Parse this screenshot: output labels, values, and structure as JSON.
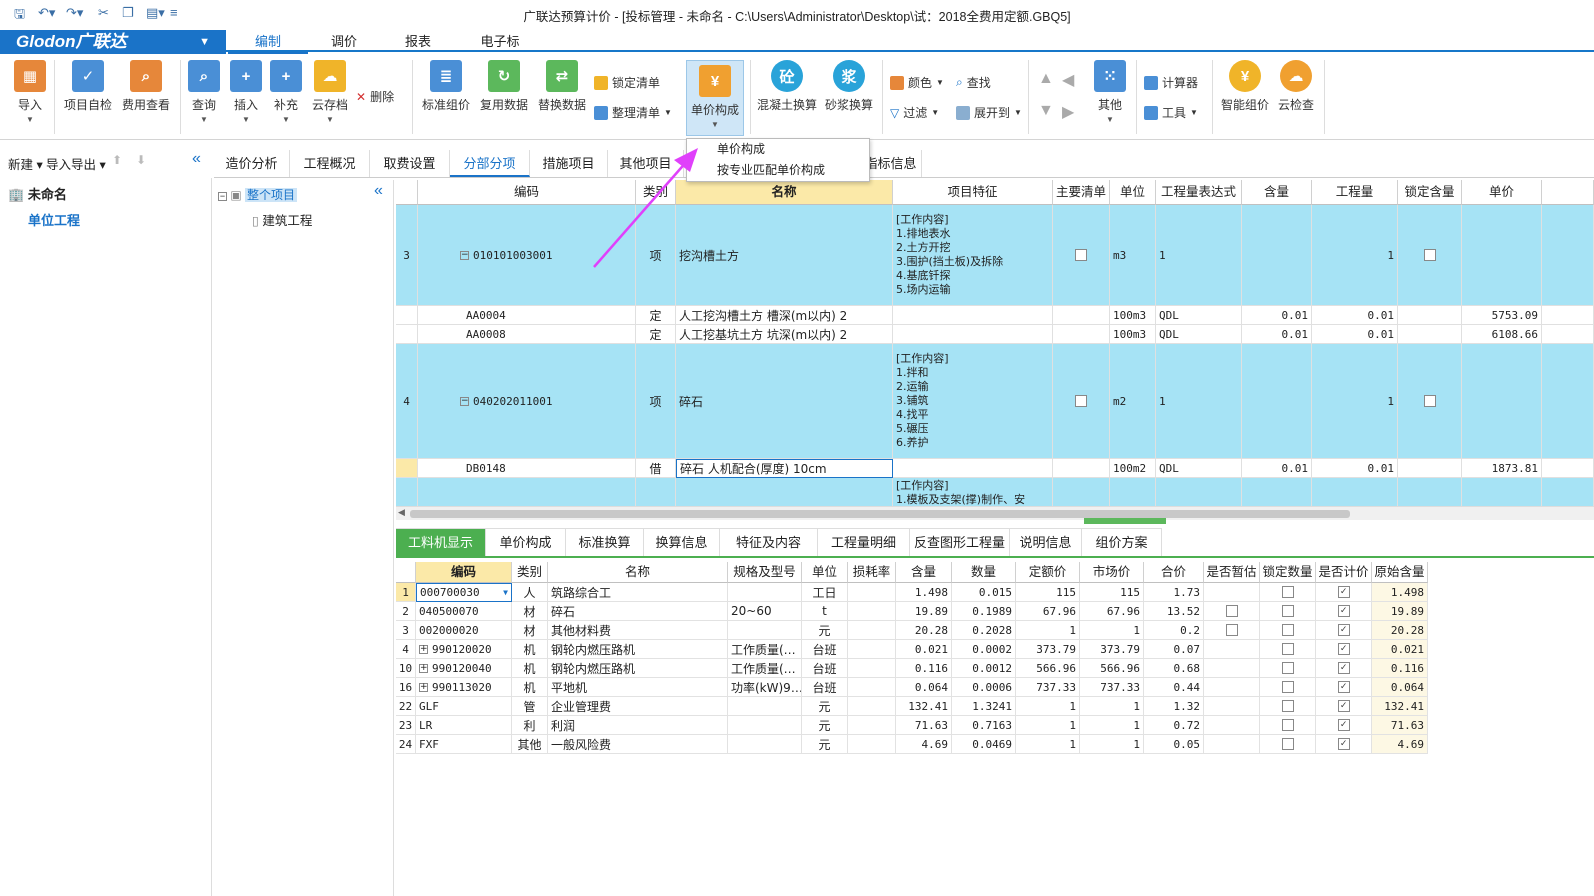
{
  "window": {
    "title": "广联达预算计价 - [投标管理 - 未命名 - C:\\Users\\Administrator\\Desktop\\试：2018全费用定额.GBQ5]"
  },
  "quick_access": [
    "save-icon",
    "undo-icon",
    "redo-icon",
    "cut-icon",
    "copy-icon",
    "paste-icon"
  ],
  "brand": {
    "logo_text": "Glodon广联达",
    "color": "#1a73c8"
  },
  "menu": {
    "tabs": [
      "编制",
      "调价",
      "报表",
      "电子标"
    ],
    "active": "编制"
  },
  "ribbon": {
    "import": "导入",
    "self_check": "项目自检",
    "fee_view": "费用查看",
    "query": "查询",
    "insert": "插入",
    "supplement": "补充",
    "cloud_archive": "云存档",
    "delete": "删除",
    "std_pricing": "标准组价",
    "reuse_data": "复用数据",
    "replace_data": "替换数据",
    "lock_list": "锁定清单",
    "organize_list": "整理清单",
    "unit_price": "单价构成",
    "concrete_swap": "混凝土换算",
    "mortar_swap": "砂浆换算",
    "concrete_glyph": "砼",
    "mortar_glyph": "浆",
    "color": "颜色",
    "find": "查找",
    "filter": "过滤",
    "expand_to": "展开到",
    "other": "其他",
    "calculator": "计算器",
    "tools": "工具",
    "smart_pricing": "智能组价",
    "cloud_check": "云检查"
  },
  "dropdown": {
    "items": [
      "单价构成",
      "按专业匹配单价构成"
    ]
  },
  "left_panel": {
    "new": "新建",
    "import_export": "导入导出",
    "root": "未命名",
    "child": "单位工程"
  },
  "doc_tabs": {
    "items": [
      "造价分析",
      "工程概况",
      "取费设置",
      "分部分项",
      "措施项目",
      "其他项目",
      "指标信息"
    ],
    "active": "分部分项"
  },
  "project_tree": {
    "root": "整个项目",
    "child": "建筑工程"
  },
  "main_grid": {
    "headers": [
      "编码",
      "类别",
      "名称",
      "项目特征",
      "主要清单",
      "单位",
      "工程量表达式",
      "含量",
      "工程量",
      "锁定含量",
      "单价"
    ],
    "rows": [
      {
        "num": "3",
        "code": "010101003001",
        "type": "项",
        "name": "挖沟槽土方",
        "feature": "[工作内容]\n1.排地表水\n2.土方开挖\n3.围护(挡土板)及拆除\n4.基底钎探\n5.场内运输",
        "main": false,
        "unit": "m3",
        "expr": "1",
        "content": "",
        "qty": "1",
        "lock": false,
        "price": ""
      },
      {
        "num": "",
        "code": "AA0004",
        "type": "定",
        "name": "人工挖沟槽土方 槽深(m以内) 2",
        "feature": "",
        "unit": "100m3",
        "expr": "QDL",
        "content": "0.01",
        "qty": "0.01",
        "price": "5753.09"
      },
      {
        "num": "",
        "code": "AA0008",
        "type": "定",
        "name": "人工挖基坑土方 坑深(m以内) 2",
        "feature": "",
        "unit": "100m3",
        "expr": "QDL",
        "content": "0.01",
        "qty": "0.01",
        "price": "6108.66"
      },
      {
        "num": "4",
        "code": "040202011001",
        "type": "项",
        "name": "碎石",
        "feature": "[工作内容]\n1.拌和\n2.运输\n3.铺筑\n4.找平\n5.碾压\n6.养护",
        "main": false,
        "unit": "m2",
        "expr": "1",
        "content": "",
        "qty": "1",
        "lock": false,
        "price": ""
      },
      {
        "num": "",
        "code": "DB0148",
        "type": "借",
        "name": "碎石 人机配合(厚度) 10cm",
        "feature": "",
        "unit": "100m2",
        "expr": "QDL",
        "content": "0.01",
        "qty": "0.01",
        "price": "1873.81"
      },
      {
        "num": "",
        "code": "",
        "type": "",
        "name": "",
        "feature": "[工作内容]\n1.模板及支架(撑)制作、安",
        "unit": "",
        "expr": "",
        "content": "",
        "qty": "",
        "price": ""
      }
    ]
  },
  "bottom_tabs": {
    "items": [
      "工料机显示",
      "单价构成",
      "标准换算",
      "换算信息",
      "特征及内容",
      "工程量明细",
      "反查图形工程量",
      "说明信息",
      "组价方案"
    ],
    "active": "工料机显示"
  },
  "bottom_grid": {
    "headers": [
      "",
      "编码",
      "类别",
      "名称",
      "规格及型号",
      "单位",
      "损耗率",
      "含量",
      "数量",
      "定额价",
      "市场价",
      "合价",
      "是否暂估",
      "锁定数量",
      "是否计价",
      "原始含量"
    ],
    "rows": [
      {
        "n": "1",
        "code": "000700030",
        "exp": false,
        "type": "人",
        "name": "筑路综合工",
        "spec": "",
        "unit": "工日",
        "loss": "",
        "content": "1.498",
        "qty": "0.015",
        "quota": "115",
        "market": "115",
        "total": "1.73",
        "est": null,
        "lock": false,
        "priced": true,
        "orig": "1.498"
      },
      {
        "n": "2",
        "code": "040500070",
        "exp": false,
        "type": "材",
        "name": "碎石",
        "spec": "20~60",
        "unit": "t",
        "loss": "",
        "content": "19.89",
        "qty": "0.1989",
        "quota": "67.96",
        "market": "67.96",
        "total": "13.52",
        "est": false,
        "lock": false,
        "priced": true,
        "orig": "19.89"
      },
      {
        "n": "3",
        "code": "002000020",
        "exp": false,
        "type": "材",
        "name": "其他材料费",
        "spec": "",
        "unit": "元",
        "loss": "",
        "content": "20.28",
        "qty": "0.2028",
        "quota": "1",
        "market": "1",
        "total": "0.2",
        "est": false,
        "lock": false,
        "priced": true,
        "orig": "20.28"
      },
      {
        "n": "4",
        "code": "990120020",
        "exp": true,
        "type": "机",
        "name": "钢轮内燃压路机",
        "spec": "工作质量(…",
        "unit": "台班",
        "loss": "",
        "content": "0.021",
        "qty": "0.0002",
        "quota": "373.79",
        "market": "373.79",
        "total": "0.07",
        "est": null,
        "lock": false,
        "priced": true,
        "orig": "0.021"
      },
      {
        "n": "10",
        "code": "990120040",
        "exp": true,
        "type": "机",
        "name": "钢轮内燃压路机",
        "spec": "工作质量(…",
        "unit": "台班",
        "loss": "",
        "content": "0.116",
        "qty": "0.0012",
        "quota": "566.96",
        "market": "566.96",
        "total": "0.68",
        "est": null,
        "lock": false,
        "priced": true,
        "orig": "0.116"
      },
      {
        "n": "16",
        "code": "990113020",
        "exp": true,
        "type": "机",
        "name": "平地机",
        "spec": "功率(kW)9…",
        "unit": "台班",
        "loss": "",
        "content": "0.064",
        "qty": "0.0006",
        "quota": "737.33",
        "market": "737.33",
        "total": "0.44",
        "est": null,
        "lock": false,
        "priced": true,
        "orig": "0.064"
      },
      {
        "n": "22",
        "code": "GLF",
        "exp": false,
        "type": "管",
        "name": "企业管理费",
        "spec": "",
        "unit": "元",
        "loss": "",
        "content": "132.41",
        "qty": "1.3241",
        "quota": "1",
        "market": "1",
        "total": "1.32",
        "est": null,
        "lock": false,
        "priced": true,
        "orig": "132.41"
      },
      {
        "n": "23",
        "code": "LR",
        "exp": false,
        "type": "利",
        "name": "利润",
        "spec": "",
        "unit": "元",
        "loss": "",
        "content": "71.63",
        "qty": "0.7163",
        "quota": "1",
        "market": "1",
        "total": "0.72",
        "est": null,
        "lock": false,
        "priced": true,
        "orig": "71.63"
      },
      {
        "n": "24",
        "code": "FXF",
        "exp": false,
        "type": "其他",
        "name": "一般风险费",
        "spec": "",
        "unit": "元",
        "loss": "",
        "content": "4.69",
        "qty": "0.0469",
        "quota": "1",
        "market": "1",
        "total": "0.05",
        "est": null,
        "lock": false,
        "priced": true,
        "orig": "4.69"
      }
    ]
  },
  "colors": {
    "row_highlight": "#a6e3f5",
    "header_selected": "#fbe9a8",
    "accent_green": "#4caf50",
    "arrow": "#e040fb"
  }
}
